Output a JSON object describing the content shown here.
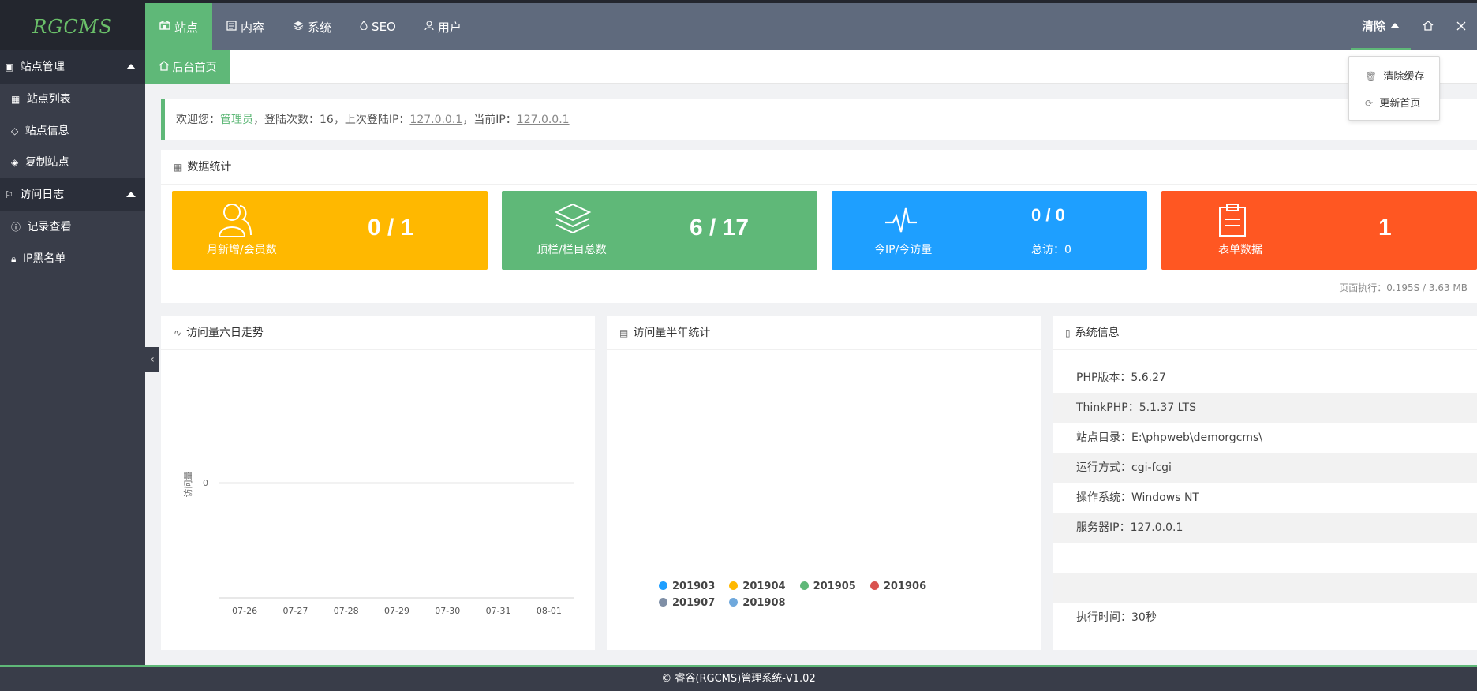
{
  "app": {
    "logo": "RGCMS"
  },
  "topnav": [
    {
      "label": "站点",
      "icon": "site-icon",
      "active": true
    },
    {
      "label": "内容",
      "icon": "content-icon"
    },
    {
      "label": "系统",
      "icon": "system-icon"
    },
    {
      "label": "SEO",
      "icon": "seo-icon"
    },
    {
      "label": "用户",
      "icon": "user-icon"
    }
  ],
  "topright": {
    "clear_label": "清除",
    "home_icon": "home-icon",
    "close_icon": "close-icon"
  },
  "dropdown": {
    "items": [
      {
        "label": "清除缓存",
        "icon": "trash-icon"
      },
      {
        "label": "更新首页",
        "icon": "refresh-icon"
      }
    ]
  },
  "sidebar": {
    "groups": [
      {
        "label": "站点管理",
        "icon": "site-manage-icon",
        "items": [
          {
            "label": "站点列表",
            "icon": "list-icon"
          },
          {
            "label": "站点信息",
            "icon": "tag-icon"
          },
          {
            "label": "复制站点",
            "icon": "layers-icon"
          }
        ]
      },
      {
        "label": "访问日志",
        "icon": "flag-icon",
        "items": [
          {
            "label": "记录查看",
            "icon": "info-icon"
          },
          {
            "label": "IP黑名单",
            "icon": "lock-icon"
          }
        ]
      }
    ]
  },
  "tab": {
    "label": "后台首页",
    "icon": "home-icon"
  },
  "welcome": {
    "prefix": "欢迎您：",
    "user": "管理员",
    "login_count_label": "，登陆次数：",
    "login_count": "16",
    "last_ip_label": "，上次登陆IP：",
    "last_ip": "127.0.0.1",
    "current_ip_label": "，当前IP：",
    "current_ip": "127.0.0.1"
  },
  "stats": {
    "title": "数据统计",
    "cards": [
      {
        "label": "月新增/会员数",
        "value": "0 / 1",
        "color": "#ffb800",
        "icon": "members-icon"
      },
      {
        "label": "顶栏/栏目总数",
        "value": "6 / 17",
        "color": "#5fb878",
        "icon": "stack-icon"
      },
      {
        "label": "今IP/今访量",
        "value": "0 / 0",
        "sub": "总访：0",
        "color": "#1e9fff",
        "icon": "pulse-icon"
      },
      {
        "label": "表单数据",
        "value": "1",
        "color": "#ff5722",
        "icon": "clipboard-icon"
      }
    ],
    "perf": "页面执行：0.195S / 3.63 MB"
  },
  "chart1": {
    "title": "访问量六日走势",
    "chart_data": {
      "type": "line",
      "categories": [
        "07-26",
        "07-27",
        "07-28",
        "07-29",
        "07-30",
        "07-31",
        "08-01"
      ],
      "ylabel": "访问量",
      "ytick_labels": [
        "0"
      ]
    }
  },
  "chart2": {
    "title": "访问量半年统计",
    "chart_data": {
      "type": "pie",
      "legend": [
        "201903",
        "201904",
        "201905",
        "201906",
        "201907",
        "201908"
      ],
      "colors": [
        "#1e9fff",
        "#ffb800",
        "#5fb878",
        "#d9534f",
        "#7f8fa6",
        "#6fa8dc"
      ]
    }
  },
  "sysinfo": {
    "title": "系统信息",
    "rows": [
      "PHP版本：5.6.27",
      "ThinkPHP：5.1.37 LTS",
      "站点目录：E:\\phpweb\\demorgcms\\",
      "运行方式：cgi-fcgi",
      "操作系统：Windows NT",
      "服务器IP：127.0.0.1",
      "",
      "",
      "执行时间：30秒"
    ]
  },
  "footer": "© 睿谷(RGCMS)管理系统-V1.02"
}
